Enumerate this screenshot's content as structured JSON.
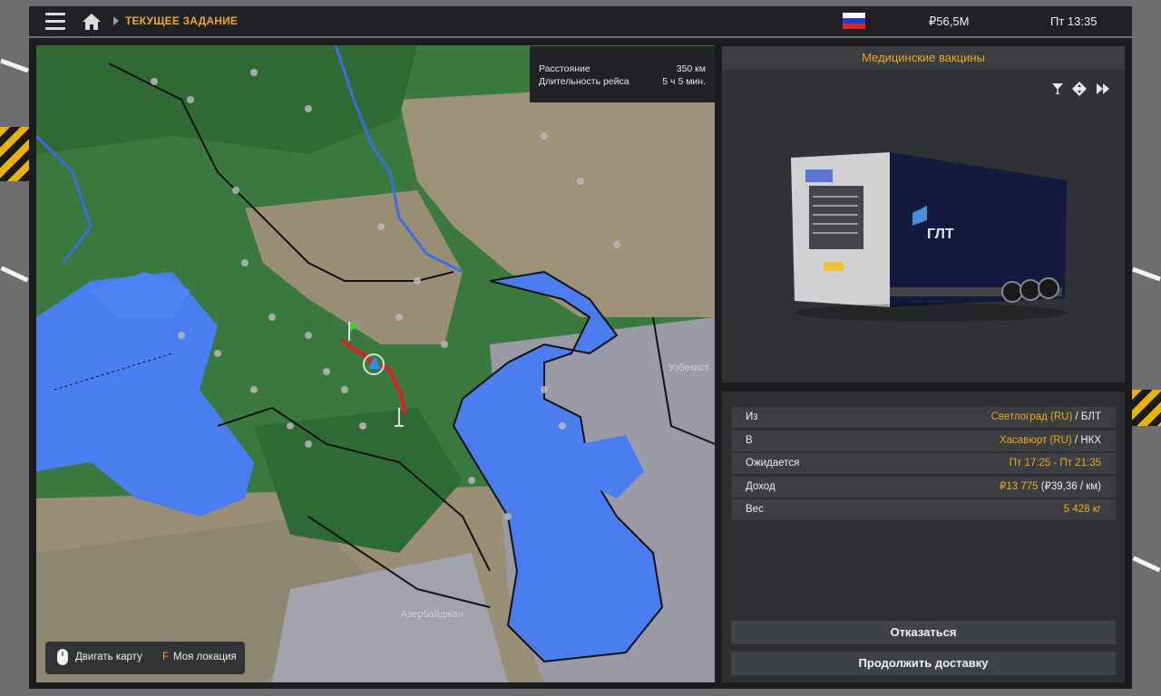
{
  "topbar": {
    "breadcrumb": "ТЕКУЩЕЕ ЗАДАНИЕ",
    "money": "₽56,5M",
    "clock": "Пт 13:35",
    "flag_colors": [
      "#ffffff",
      "#1c3fd1",
      "#e0261b"
    ],
    "menu_icon": "hamburger-icon",
    "home_icon": "home-icon"
  },
  "map": {
    "info": {
      "distance_label": "Расстояние",
      "distance_value": "350 км",
      "duration_label": "Длительность рейса",
      "duration_value": "5 ч 5 мин."
    },
    "labels": {
      "uzbekistan": "Узбекист",
      "azerbaijan": "Азербайджан"
    },
    "hint": {
      "move_label": "Двигать карту",
      "key": "F",
      "location_label": "Моя локация"
    },
    "route_color": "#e21d1d"
  },
  "cargo": {
    "title": "Медицинские вакцины",
    "tool_icons": [
      "cocktail-glass-icon",
      "diamond-arrows-icon",
      "fast-forward-icon"
    ]
  },
  "details": {
    "rows": [
      {
        "label": "Из",
        "value": "Светлоград (RU)",
        "suffix": " / БЛТ"
      },
      {
        "label": "В",
        "value": "Хасавюрт (RU)",
        "suffix": " / НКХ"
      },
      {
        "label": "Ожидается",
        "value": "Пт 17:25 - Пт 21:35",
        "suffix": ""
      },
      {
        "label": "Доход",
        "value": "₽13 775",
        "suffix": " (₽39,36 / км)"
      },
      {
        "label": "Вес",
        "value": "5 428 кг",
        "suffix": ""
      }
    ]
  },
  "buttons": {
    "decline": "Отказаться",
    "continue": "Продолжить доставку"
  },
  "accent_color": "#f0a81e"
}
